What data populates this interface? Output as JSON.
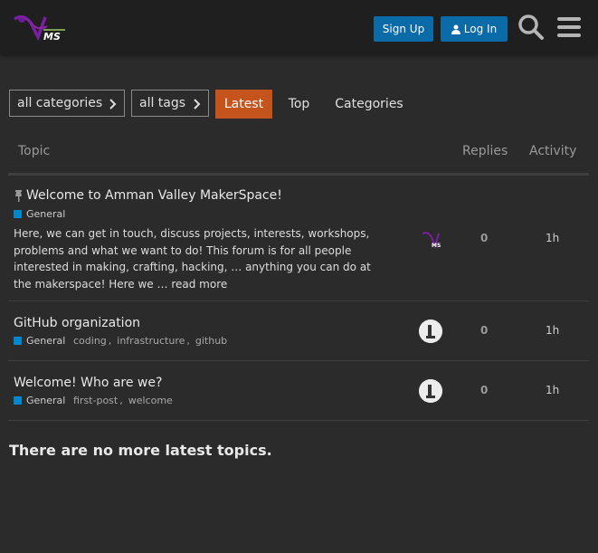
{
  "header": {
    "logo_text": "MS",
    "signup_label": "Sign Up",
    "login_label": "Log In",
    "search_icon": "search-icon",
    "menu_icon": "hamburger-menu-icon",
    "button_color": "#0b6aa8"
  },
  "nav": {
    "category_dropdown": "all categories",
    "tag_dropdown": "all tags",
    "tabs": [
      {
        "label": "Latest",
        "active": true
      },
      {
        "label": "Top",
        "active": false
      },
      {
        "label": "Categories",
        "active": false
      }
    ],
    "active_color": "#c4541c"
  },
  "table": {
    "columns": {
      "topic": "Topic",
      "replies": "Replies",
      "activity": "Activity"
    },
    "rows": [
      {
        "title": "Welcome to Amman Valley MakerSpace!",
        "pinned": true,
        "category": "General",
        "category_color": "#0088cc",
        "tags": [],
        "excerpt": "Here, we can get in touch, discuss projects, interests, workshops, problems and what we want to do! This forum is for all people interested in making, crafting, hacking, … anything you can do at the makerspace! Here we …",
        "read_more": "read more",
        "replies": "0",
        "activity": "1h"
      },
      {
        "title": "GitHub organization",
        "pinned": false,
        "category": "General",
        "category_color": "#0088cc",
        "tags": [
          "coding",
          "infrastructure",
          "github"
        ],
        "replies": "0",
        "activity": "1h"
      },
      {
        "title": "Welcome! Who are we?",
        "pinned": false,
        "category": "General",
        "category_color": "#0088cc",
        "tags": [
          "first-post",
          "welcome"
        ],
        "replies": "0",
        "activity": "1h"
      }
    ]
  },
  "footer_message": "There are no more latest topics."
}
